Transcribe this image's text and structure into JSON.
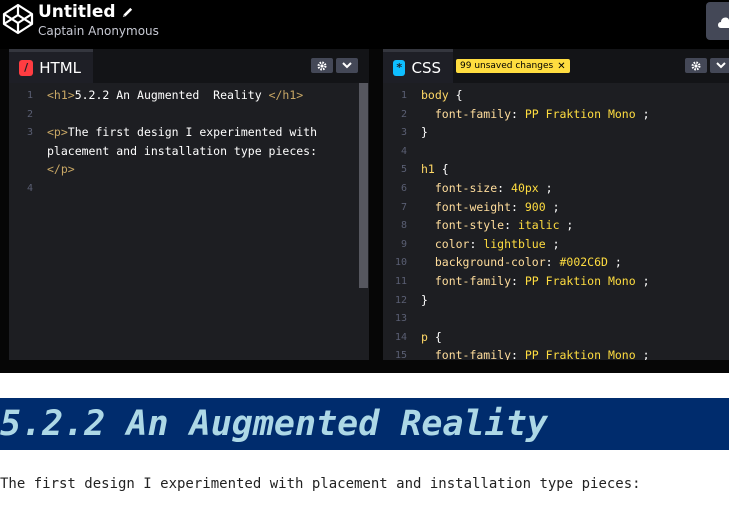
{
  "header": {
    "pen_title": "Untitled",
    "author": "Captain Anonymous"
  },
  "html_pane": {
    "tab_label": "HTML",
    "icon_glyph": "/",
    "lines": [
      {
        "n": "1",
        "parts": [
          {
            "c": "tag",
            "t": "<h1>"
          },
          {
            "c": "plain",
            "t": "5.2.2 An Augmented  Reality "
          },
          {
            "c": "tag",
            "t": "</h1>"
          }
        ]
      },
      {
        "n": "2",
        "parts": []
      },
      {
        "n": "3",
        "parts": [
          {
            "c": "tag",
            "t": "<p>"
          },
          {
            "c": "plain",
            "t": "The first design I experimented with"
          }
        ]
      },
      {
        "n": "",
        "parts": [
          {
            "c": "plain",
            "t": "placement and installation type pieces:"
          }
        ]
      },
      {
        "n": "",
        "parts": [
          {
            "c": "tag",
            "t": "</p>"
          }
        ]
      },
      {
        "n": "4",
        "parts": []
      }
    ]
  },
  "css_pane": {
    "tab_label": "CSS",
    "icon_glyph": "*",
    "unsaved_label": "99 unsaved changes",
    "lines": [
      {
        "n": "1",
        "parts": [
          {
            "c": "sel",
            "t": "body"
          },
          {
            "c": "punc",
            "t": " {"
          }
        ]
      },
      {
        "n": "2",
        "parts": [
          {
            "c": "prop",
            "t": "  font-family"
          },
          {
            "c": "punc",
            "t": ": "
          },
          {
            "c": "val",
            "t": "PP Fraktion Mono"
          },
          {
            "c": "punc",
            "t": " ;"
          }
        ]
      },
      {
        "n": "3",
        "parts": [
          {
            "c": "punc",
            "t": "}"
          }
        ]
      },
      {
        "n": "4",
        "parts": []
      },
      {
        "n": "5",
        "parts": [
          {
            "c": "sel",
            "t": "h1"
          },
          {
            "c": "punc",
            "t": " {"
          }
        ]
      },
      {
        "n": "6",
        "parts": [
          {
            "c": "prop",
            "t": "  font-size"
          },
          {
            "c": "punc",
            "t": ": "
          },
          {
            "c": "val",
            "t": "40px"
          },
          {
            "c": "punc",
            "t": " ;"
          }
        ]
      },
      {
        "n": "7",
        "parts": [
          {
            "c": "prop",
            "t": "  font-weight"
          },
          {
            "c": "punc",
            "t": ": "
          },
          {
            "c": "val",
            "t": "900"
          },
          {
            "c": "punc",
            "t": " ;"
          }
        ]
      },
      {
        "n": "8",
        "parts": [
          {
            "c": "prop",
            "t": "  font-style"
          },
          {
            "c": "punc",
            "t": ": "
          },
          {
            "c": "val",
            "t": "italic"
          },
          {
            "c": "punc",
            "t": " ;"
          }
        ]
      },
      {
        "n": "9",
        "parts": [
          {
            "c": "prop",
            "t": "  color"
          },
          {
            "c": "punc",
            "t": ": "
          },
          {
            "c": "val",
            "t": "lightblue"
          },
          {
            "c": "punc",
            "t": " ;"
          }
        ]
      },
      {
        "n": "10",
        "parts": [
          {
            "c": "prop",
            "t": "  background-color"
          },
          {
            "c": "punc",
            "t": ": "
          },
          {
            "c": "val",
            "t": "#002C6D"
          },
          {
            "c": "punc",
            "t": " ;"
          }
        ]
      },
      {
        "n": "11",
        "parts": [
          {
            "c": "prop",
            "t": "  font-family"
          },
          {
            "c": "punc",
            "t": ": "
          },
          {
            "c": "val",
            "t": "PP Fraktion Mono"
          },
          {
            "c": "punc",
            "t": " ;"
          }
        ]
      },
      {
        "n": "12",
        "parts": [
          {
            "c": "punc",
            "t": "}"
          }
        ]
      },
      {
        "n": "13",
        "parts": []
      },
      {
        "n": "14",
        "parts": [
          {
            "c": "sel",
            "t": "p"
          },
          {
            "c": "punc",
            "t": " {"
          }
        ]
      },
      {
        "n": "15",
        "parts": [
          {
            "c": "prop",
            "t": "  font-family"
          },
          {
            "c": "punc",
            "t": ": "
          },
          {
            "c": "val",
            "t": "PP Fraktion Mono"
          },
          {
            "c": "punc",
            "t": " ;"
          }
        ]
      }
    ]
  },
  "preview": {
    "h1": "5.2.2 An Augmented  Reality",
    "p": "The first design I experimented with placement and installation type pieces:"
  },
  "colors": {
    "html_accent": "#ff3c41",
    "css_accent": "#0ebeff",
    "unsaved_badge": "#ffdd40",
    "preview_h1_bg": "#002c6d",
    "preview_h1_fg": "#add8e6"
  }
}
